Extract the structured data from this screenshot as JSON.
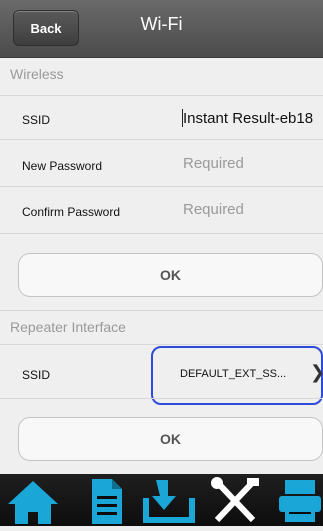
{
  "header": {
    "back_label": "Back",
    "title": "Wi-Fi"
  },
  "wireless": {
    "section_label": "Wireless",
    "ssid_label": "SSID",
    "ssid_value": "Instant Result-eb18",
    "new_password_label": "New Password",
    "new_password_placeholder": "Required",
    "confirm_password_label": "Confirm Password",
    "confirm_password_placeholder": "Required",
    "ok_label": "OK"
  },
  "repeater": {
    "section_label": "Repeater Interface",
    "ssid_label": "SSID",
    "ssid_value": "DEFAULT_EXT_SS...",
    "ok_label": "OK"
  },
  "tabbar": {
    "tabs": [
      "home-icon",
      "document-icon",
      "download-icon",
      "tools-icon",
      "printer-icon"
    ],
    "accent_color": "#1aa7d8"
  }
}
